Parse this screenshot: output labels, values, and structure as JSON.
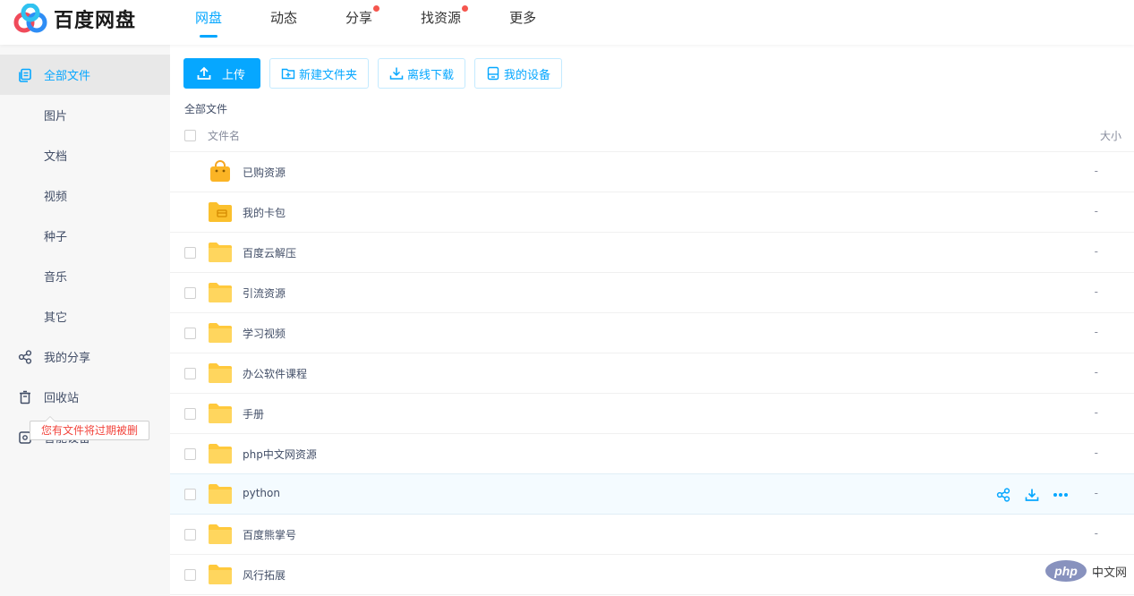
{
  "brand": {
    "name": "百度网盘",
    "colors": {
      "accent": "#06a7ff",
      "dot": "#f5564e",
      "logo_blue": "#2e8df5",
      "logo_red": "#f04a5a",
      "logo_cyan": "#30c2f0"
    }
  },
  "nav": [
    {
      "label": "网盘",
      "active": true,
      "dot": false
    },
    {
      "label": "动态",
      "active": false,
      "dot": false
    },
    {
      "label": "分享",
      "active": false,
      "dot": true
    },
    {
      "label": "找资源",
      "active": false,
      "dot": true
    },
    {
      "label": "更多",
      "active": false,
      "dot": false
    }
  ],
  "sidebar": {
    "items": [
      {
        "label": "全部文件",
        "icon": "copy-icon",
        "active": true
      },
      {
        "label": "图片",
        "sub": true
      },
      {
        "label": "文档",
        "sub": true
      },
      {
        "label": "视频",
        "sub": true
      },
      {
        "label": "种子",
        "sub": true
      },
      {
        "label": "音乐",
        "sub": true
      },
      {
        "label": "其它",
        "sub": true
      },
      {
        "label": "我的分享",
        "icon": "share-icon"
      },
      {
        "label": "回收站",
        "icon": "trash-icon"
      },
      {
        "label": "智能设备",
        "icon": "device-icon"
      }
    ],
    "tooltip": "您有文件将过期被删"
  },
  "toolbar": {
    "upload": "上传",
    "new_folder": "新建文件夹",
    "offline_download": "离线下载",
    "my_devices": "我的设备"
  },
  "breadcrumb": "全部文件",
  "table": {
    "col_name": "文件名",
    "col_size": "大小"
  },
  "files": [
    {
      "name": "已购资源",
      "size": "-",
      "icon": "shopping-bag-icon",
      "checkbox": false
    },
    {
      "name": "我的卡包",
      "size": "-",
      "icon": "card-folder-icon",
      "checkbox": false
    },
    {
      "name": "百度云解压",
      "size": "-",
      "icon": "folder-icon",
      "checkbox": true
    },
    {
      "name": "引流资源",
      "size": "-",
      "icon": "folder-icon",
      "checkbox": true
    },
    {
      "name": "学习视频",
      "size": "-",
      "icon": "folder-icon",
      "checkbox": true
    },
    {
      "name": "办公软件课程",
      "size": "-",
      "icon": "folder-icon",
      "checkbox": true
    },
    {
      "name": "手册",
      "size": "-",
      "icon": "folder-icon",
      "checkbox": true
    },
    {
      "name": "php中文网资源",
      "size": "-",
      "icon": "folder-icon",
      "checkbox": true
    },
    {
      "name": "python",
      "size": "-",
      "icon": "folder-icon",
      "checkbox": true,
      "hover": true
    },
    {
      "name": "百度熊掌号",
      "size": "-",
      "icon": "folder-icon",
      "checkbox": true
    },
    {
      "name": "风行拓展",
      "size": "-",
      "icon": "folder-icon",
      "checkbox": true
    }
  ],
  "watermark": {
    "badge": "php",
    "text": "中文网"
  }
}
